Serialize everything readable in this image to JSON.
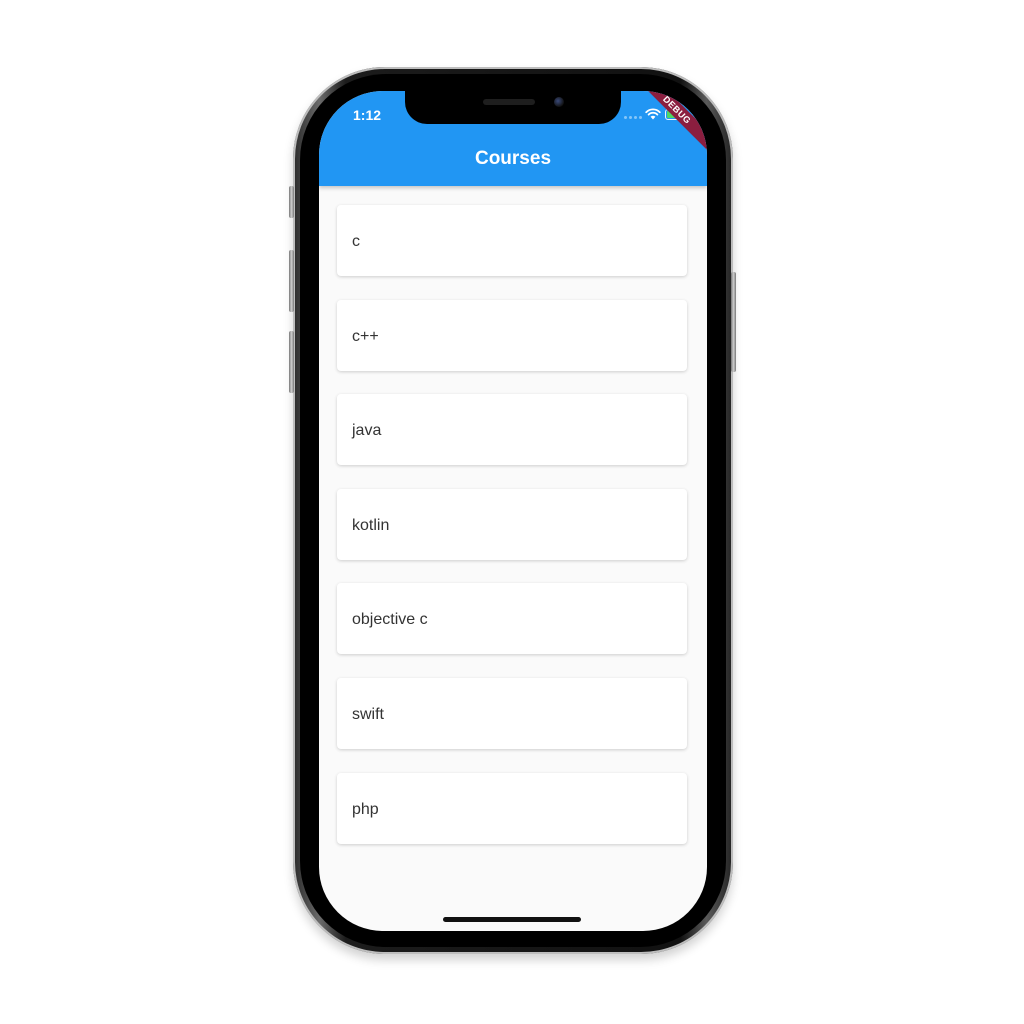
{
  "status_bar": {
    "time": "1:12",
    "debug_label": "DEBUG",
    "battery_color": "#4cd964"
  },
  "app_bar": {
    "title": "Courses",
    "color": "#2196f3"
  },
  "courses": [
    {
      "label": "c"
    },
    {
      "label": "c++"
    },
    {
      "label": "java"
    },
    {
      "label": "kotlin"
    },
    {
      "label": "objective c"
    },
    {
      "label": "swift"
    },
    {
      "label": "php"
    }
  ],
  "icons": [
    "wifi-icon",
    "battery-icon",
    "signal-dots-icon"
  ]
}
